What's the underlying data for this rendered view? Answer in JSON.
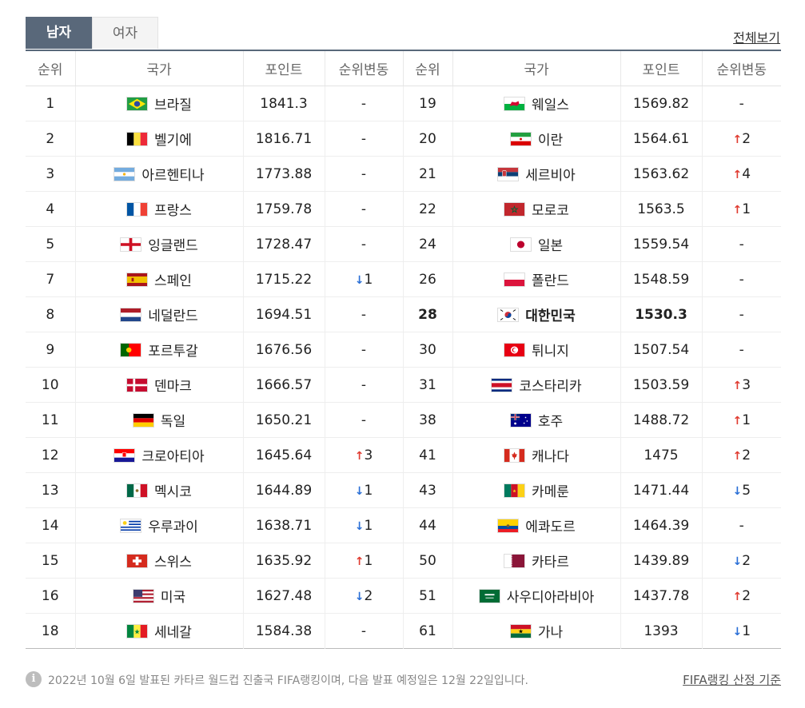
{
  "tabs": {
    "men": "남자",
    "women": "여자"
  },
  "view_all": "전체보기",
  "headers": [
    "순위",
    "국가",
    "포인트",
    "순위변동",
    "순위",
    "국가",
    "포인트",
    "순위변동"
  ],
  "left": [
    {
      "rank": "1",
      "country": "브라질",
      "points": "1841.3",
      "change": "-",
      "flag": "brazil"
    },
    {
      "rank": "2",
      "country": "벨기에",
      "points": "1816.71",
      "change": "-",
      "flag": "belgium"
    },
    {
      "rank": "3",
      "country": "아르헨티나",
      "points": "1773.88",
      "change": "-",
      "flag": "argentina"
    },
    {
      "rank": "4",
      "country": "프랑스",
      "points": "1759.78",
      "change": "-",
      "flag": "france"
    },
    {
      "rank": "5",
      "country": "잉글랜드",
      "points": "1728.47",
      "change": "-",
      "flag": "england"
    },
    {
      "rank": "7",
      "country": "스페인",
      "points": "1715.22",
      "change": "1",
      "dir": "down",
      "flag": "spain"
    },
    {
      "rank": "8",
      "country": "네덜란드",
      "points": "1694.51",
      "change": "-",
      "flag": "netherlands"
    },
    {
      "rank": "9",
      "country": "포르투갈",
      "points": "1676.56",
      "change": "-",
      "flag": "portugal"
    },
    {
      "rank": "10",
      "country": "덴마크",
      "points": "1666.57",
      "change": "-",
      "flag": "denmark"
    },
    {
      "rank": "11",
      "country": "독일",
      "points": "1650.21",
      "change": "-",
      "flag": "germany"
    },
    {
      "rank": "12",
      "country": "크로아티아",
      "points": "1645.64",
      "change": "3",
      "dir": "up",
      "flag": "croatia"
    },
    {
      "rank": "13",
      "country": "멕시코",
      "points": "1644.89",
      "change": "1",
      "dir": "down",
      "flag": "mexico"
    },
    {
      "rank": "14",
      "country": "우루과이",
      "points": "1638.71",
      "change": "1",
      "dir": "down",
      "flag": "uruguay"
    },
    {
      "rank": "15",
      "country": "스위스",
      "points": "1635.92",
      "change": "1",
      "dir": "up",
      "flag": "switzerland"
    },
    {
      "rank": "16",
      "country": "미국",
      "points": "1627.48",
      "change": "2",
      "dir": "down",
      "flag": "usa"
    },
    {
      "rank": "18",
      "country": "세네갈",
      "points": "1584.38",
      "change": "-",
      "flag": "senegal"
    }
  ],
  "right": [
    {
      "rank": "19",
      "country": "웨일스",
      "points": "1569.82",
      "change": "-",
      "flag": "wales"
    },
    {
      "rank": "20",
      "country": "이란",
      "points": "1564.61",
      "change": "2",
      "dir": "up",
      "flag": "iran"
    },
    {
      "rank": "21",
      "country": "세르비아",
      "points": "1563.62",
      "change": "4",
      "dir": "up",
      "flag": "serbia"
    },
    {
      "rank": "22",
      "country": "모로코",
      "points": "1563.5",
      "change": "1",
      "dir": "up",
      "flag": "morocco"
    },
    {
      "rank": "24",
      "country": "일본",
      "points": "1559.54",
      "change": "-",
      "flag": "japan"
    },
    {
      "rank": "26",
      "country": "폴란드",
      "points": "1548.59",
      "change": "-",
      "flag": "poland"
    },
    {
      "rank": "28",
      "country": "대한민국",
      "points": "1530.3",
      "change": "-",
      "flag": "korea",
      "highlight": true
    },
    {
      "rank": "30",
      "country": "튀니지",
      "points": "1507.54",
      "change": "-",
      "flag": "tunisia"
    },
    {
      "rank": "31",
      "country": "코스타리카",
      "points": "1503.59",
      "change": "3",
      "dir": "up",
      "flag": "costarica"
    },
    {
      "rank": "38",
      "country": "호주",
      "points": "1488.72",
      "change": "1",
      "dir": "up",
      "flag": "australia"
    },
    {
      "rank": "41",
      "country": "캐나다",
      "points": "1475",
      "change": "2",
      "dir": "up",
      "flag": "canada"
    },
    {
      "rank": "43",
      "country": "카메룬",
      "points": "1471.44",
      "change": "5",
      "dir": "down",
      "flag": "cameroon"
    },
    {
      "rank": "44",
      "country": "에콰도르",
      "points": "1464.39",
      "change": "-",
      "flag": "ecuador"
    },
    {
      "rank": "50",
      "country": "카타르",
      "points": "1439.89",
      "change": "2",
      "dir": "down",
      "flag": "qatar"
    },
    {
      "rank": "51",
      "country": "사우디아라비아",
      "points": "1437.78",
      "change": "2",
      "dir": "up",
      "flag": "saudi"
    },
    {
      "rank": "61",
      "country": "가나",
      "points": "1393",
      "change": "1",
      "dir": "down",
      "flag": "ghana"
    }
  ],
  "footer": {
    "note": "2022년 10월 6일 발표된 카타르 월드컵 진출국 FIFA랭킹이며, 다음 발표 예정일은 12월 22일입니다.",
    "criteria": "FIFA랭킹 산정 기준"
  },
  "colors": {
    "header_bar": "#59687a",
    "up": "#e03c31",
    "down": "#2a6fd6"
  }
}
